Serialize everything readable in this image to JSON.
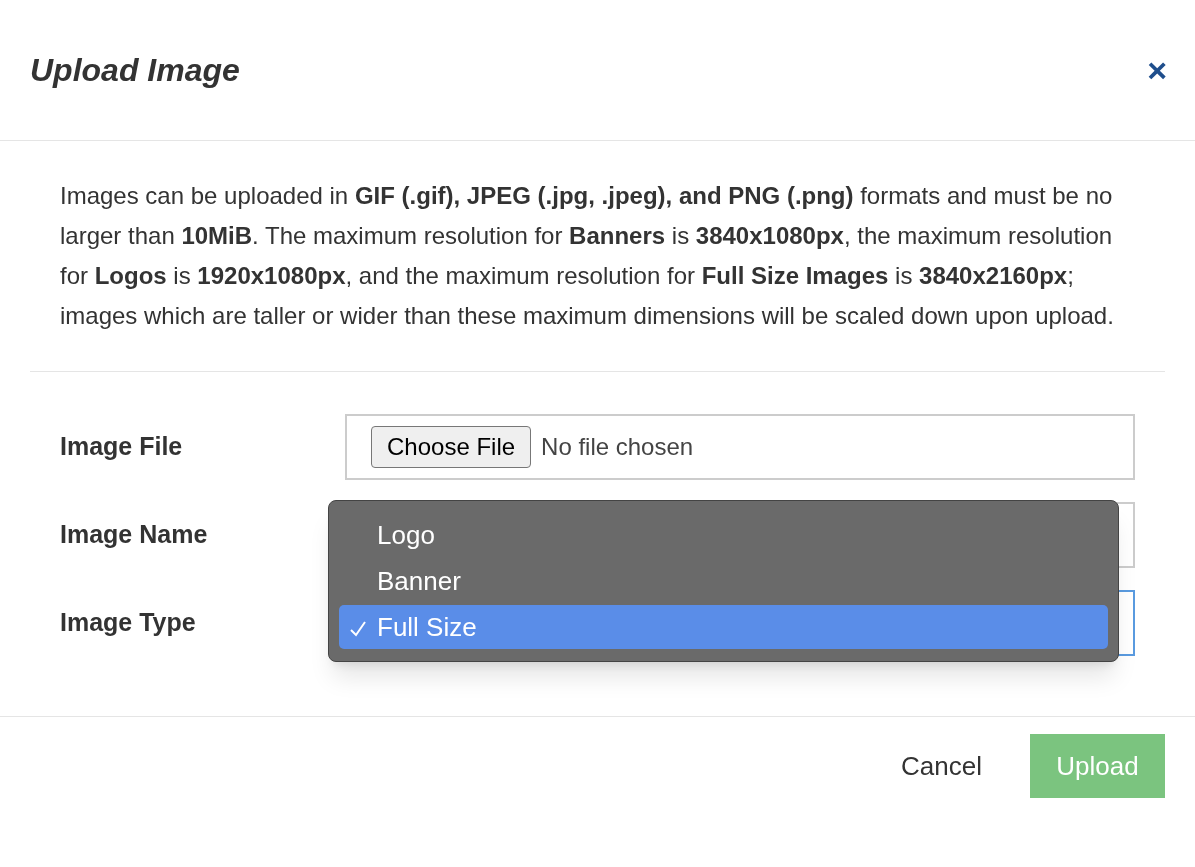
{
  "dialog": {
    "title": "Upload Image",
    "close": "×"
  },
  "description": "Images can be uploaded in **GIF (.gif), JPEG (.jpg, .jpeg), and PNG (.png)** formats and must be no larger than **10MiB**. The maximum resolution for **Banners** is **3840x1080px**, the maximum resolution for **Logos** is **1920x1080px**, and the maximum resolution for **Full Size Images** is **3840x2160px**; images which are taller or wider than these maximum dimensions will be scaled down upon upload.",
  "fields": [
    {
      "label": "Image File",
      "kind": "file",
      "button": "Choose File",
      "value": "No file chosen"
    },
    {
      "label": "Image Name",
      "kind": "text"
    },
    {
      "label": "Image Type",
      "kind": "select",
      "focused": true
    }
  ],
  "dropdown": {
    "options": [
      {
        "label": "Logo",
        "selected": false
      },
      {
        "label": "Banner",
        "selected": false
      },
      {
        "label": "Full Size",
        "selected": true
      }
    ]
  },
  "footer": {
    "cancel": "Cancel",
    "submit": "Upload"
  }
}
